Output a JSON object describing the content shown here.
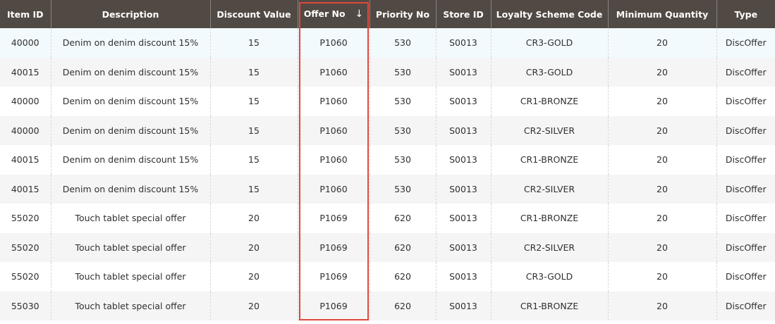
{
  "columns": [
    {
      "key": "item_id",
      "label": "Item ID"
    },
    {
      "key": "description",
      "label": "Description"
    },
    {
      "key": "discount_value",
      "label": "Discount Value"
    },
    {
      "key": "offer_no",
      "label": "Offer No",
      "sort": "↓"
    },
    {
      "key": "priority_no",
      "label": "Priority No"
    },
    {
      "key": "store_id",
      "label": "Store ID"
    },
    {
      "key": "loyalty_scheme_code",
      "label": "Loyalty Scheme Code"
    },
    {
      "key": "minimum_quantity",
      "label": "Minimum Quantity"
    },
    {
      "key": "type",
      "label": "Type"
    }
  ],
  "rows": [
    [
      "40000",
      "Denim on denim discount 15%",
      "15",
      "P1060",
      "530",
      "S0013",
      "CR3-GOLD",
      "20",
      "DiscOffer"
    ],
    [
      "40015",
      "Denim on denim discount 15%",
      "15",
      "P1060",
      "530",
      "S0013",
      "CR3-GOLD",
      "20",
      "DiscOffer"
    ],
    [
      "40000",
      "Denim on denim discount 15%",
      "15",
      "P1060",
      "530",
      "S0013",
      "CR1-BRONZE",
      "20",
      "DiscOffer"
    ],
    [
      "40000",
      "Denim on denim discount 15%",
      "15",
      "P1060",
      "530",
      "S0013",
      "CR2-SILVER",
      "20",
      "DiscOffer"
    ],
    [
      "40015",
      "Denim on denim discount 15%",
      "15",
      "P1060",
      "530",
      "S0013",
      "CR1-BRONZE",
      "20",
      "DiscOffer"
    ],
    [
      "40015",
      "Denim on denim discount 15%",
      "15",
      "P1060",
      "530",
      "S0013",
      "CR2-SILVER",
      "20",
      "DiscOffer"
    ],
    [
      "55020",
      "Touch tablet special offer",
      "20",
      "P1069",
      "620",
      "S0013",
      "CR1-BRONZE",
      "20",
      "DiscOffer"
    ],
    [
      "55020",
      "Touch tablet special offer",
      "20",
      "P1069",
      "620",
      "S0013",
      "CR2-SILVER",
      "20",
      "DiscOffer"
    ],
    [
      "55020",
      "Touch tablet special offer",
      "20",
      "P1069",
      "620",
      "S0013",
      "CR3-GOLD",
      "20",
      "DiscOffer"
    ],
    [
      "55030",
      "Touch tablet special offer",
      "20",
      "P1069",
      "620",
      "S0013",
      "CR1-BRONZE",
      "20",
      "DiscOffer"
    ]
  ],
  "colors": {
    "header_bg": "#514943",
    "highlight": "#e0473d",
    "hover_row": "#f2fafd"
  }
}
